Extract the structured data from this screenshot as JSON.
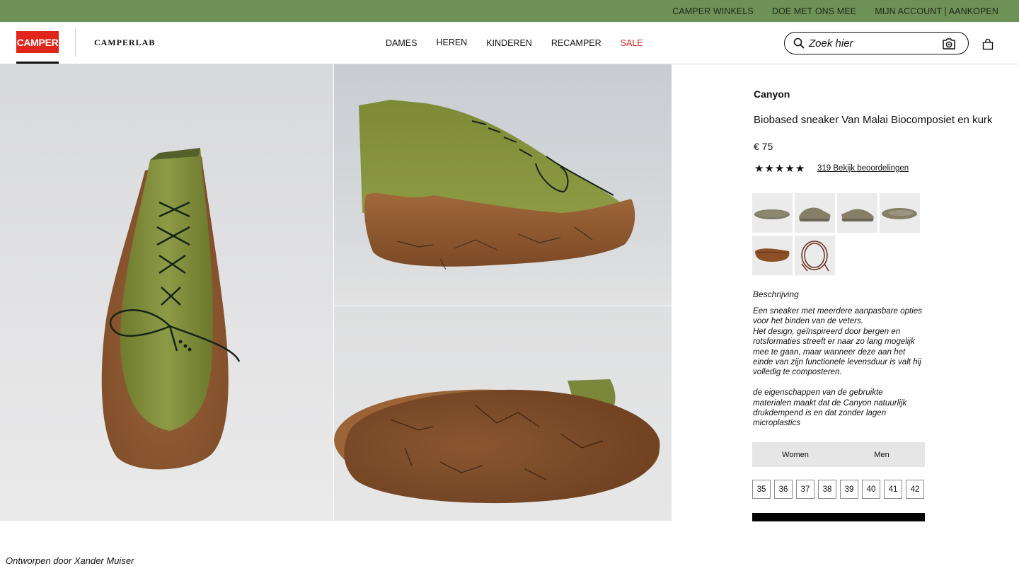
{
  "topbar": {
    "links": [
      "CAMPER WINKELS",
      "DOE MET ONS MEE",
      "MIJN ACCOUNT | AANKOPEN"
    ]
  },
  "header": {
    "logo_text": "CAMPER",
    "lab_text": "CAMPERLAB",
    "nav": [
      "DAMES",
      "HEREN",
      "KINDEREN",
      "RECAMPER",
      "SALE"
    ],
    "search_placeholder": "Zoek hier"
  },
  "product": {
    "brand": "Canyon",
    "title": "Biobased sneaker Van Malai Biocomposiet en kurk",
    "price": "€ 75",
    "rating_stars": 5,
    "reviews_label": "319 Bekijk beoordelingen",
    "description_heading": "Beschrijving",
    "description": "Een sneaker met meerdere aanpasbare opties\nvoor het binden van de veters.\nHet design, geïnspireerd door bergen en\nrotsformaties streeft er naar zo lang mogelijk\nmee te gaan, maar wanneer deze aan het\neinde van zijn functionele levensduur is valt hij\nvolledig te composteren.\n\nde eigenschappen van de gebruikte\nmaterialen maakt dat de Canyon natuurlijk\ndrukdempend is en dat zonder lagen\nmicroplastics",
    "gender_options": [
      "Women",
      "Men"
    ],
    "sizes": [
      "35",
      "36",
      "37",
      "38",
      "39",
      "40",
      "41",
      "42"
    ]
  },
  "footer": {
    "credit": "Ontworpen door Xander Muiser"
  },
  "colors": {
    "topbar_green": "#6e9157",
    "brand_red": "#e1251b",
    "felt_green": "#7d8a38",
    "cork_brown": "#8a5530"
  },
  "icons": [
    "search-icon",
    "camera-search-icon",
    "shopping-bag-icon",
    "star-icon"
  ]
}
